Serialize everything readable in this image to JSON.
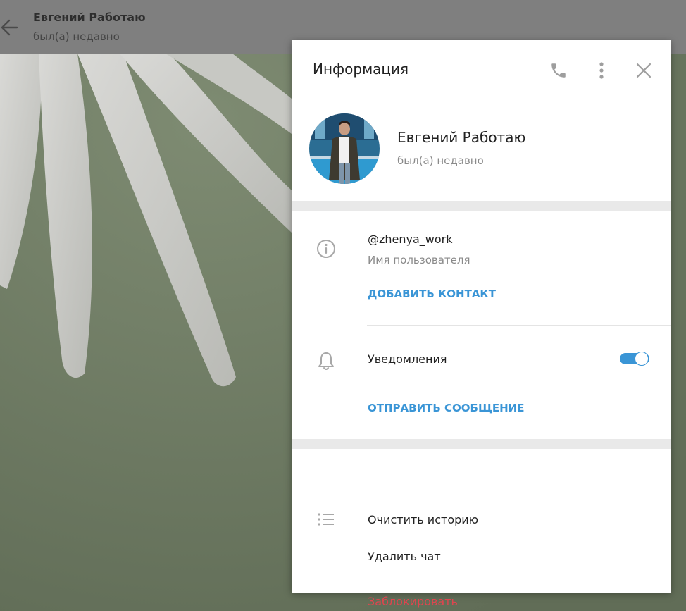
{
  "header": {
    "title": "Евгений Работаю",
    "status": "был(а) недавно"
  },
  "panel": {
    "title": "Информация",
    "profile": {
      "name": "Евгений Работаю",
      "status": "был(а) недавно"
    },
    "info": {
      "username": "@zhenya_work",
      "username_label": "Имя пользователя",
      "add_contact": "ДОБАВИТЬ КОНТАКТ"
    },
    "notifications": {
      "label": "Уведомления",
      "enabled": true,
      "send_message": "ОТПРАВИТЬ СООБЩЕНИЕ"
    },
    "actions": {
      "clear_history": "Очистить историю",
      "delete_chat": "Удалить чат",
      "block": "Заблокировать"
    }
  },
  "icons": {
    "back": "arrow-left-icon",
    "phone": "phone-icon",
    "more": "more-vertical-icon",
    "close": "close-icon",
    "info": "info-circle-icon",
    "bell": "bell-icon",
    "list": "list-icon"
  },
  "colors": {
    "accent": "#3a95d6",
    "danger": "#e0454f",
    "icon": "#a8a8a8",
    "header_bg": "#7f7f7f"
  }
}
